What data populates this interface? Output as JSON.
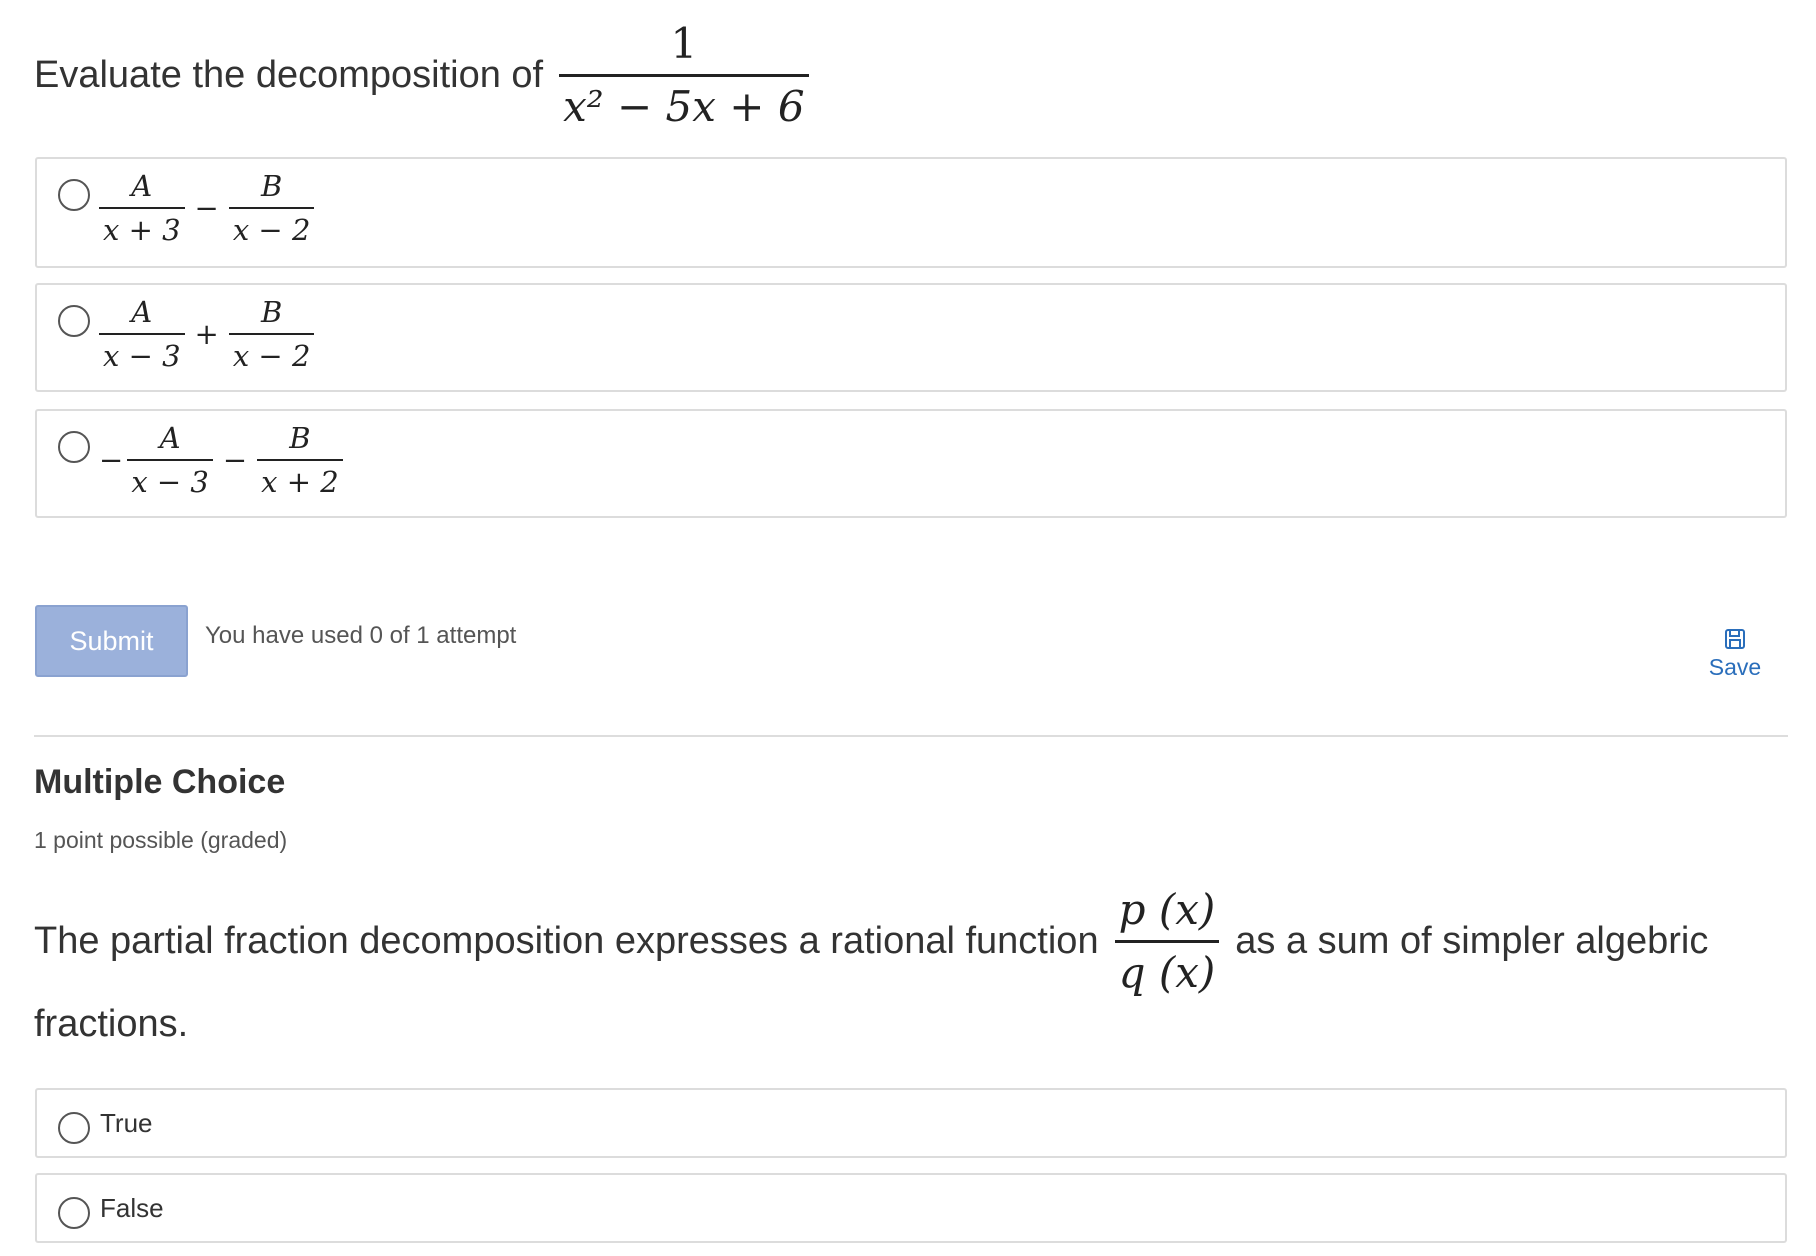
{
  "question1": {
    "prompt": "Evaluate the decomposition of",
    "fraction": {
      "numerator": "1",
      "denominator": "x² − 5x + 6"
    },
    "options": [
      {
        "lead": "",
        "num1": "A",
        "den1": "x + 3",
        "op": "−",
        "num2": "B",
        "den2": "x − 2"
      },
      {
        "lead": "",
        "num1": "A",
        "den1": "x − 3",
        "op": "+",
        "num2": "B",
        "den2": "x − 2"
      },
      {
        "lead": "−",
        "num1": "A",
        "den1": "x − 3",
        "op": "−",
        "num2": "B",
        "den2": "x + 2"
      }
    ]
  },
  "actions": {
    "submit_label": "Submit",
    "attempts_text": "You have used 0 of 1 attempt",
    "save_label": "Save",
    "save_icon": "floppy-disk-icon"
  },
  "question2": {
    "section_title": "Multiple Choice",
    "points": "1 point possible (graded)",
    "text_before": "The partial fraction decomposition expresses a rational function",
    "fraction": {
      "numerator": "p (x)",
      "denominator": "q (x)"
    },
    "text_after": "as a sum of simpler algebric",
    "text_line2": "fractions.",
    "options": [
      "True",
      "False"
    ]
  },
  "colors": {
    "submit_bg": "#9bb1db",
    "link": "#2a6ebb",
    "border": "#dcdcdc"
  }
}
